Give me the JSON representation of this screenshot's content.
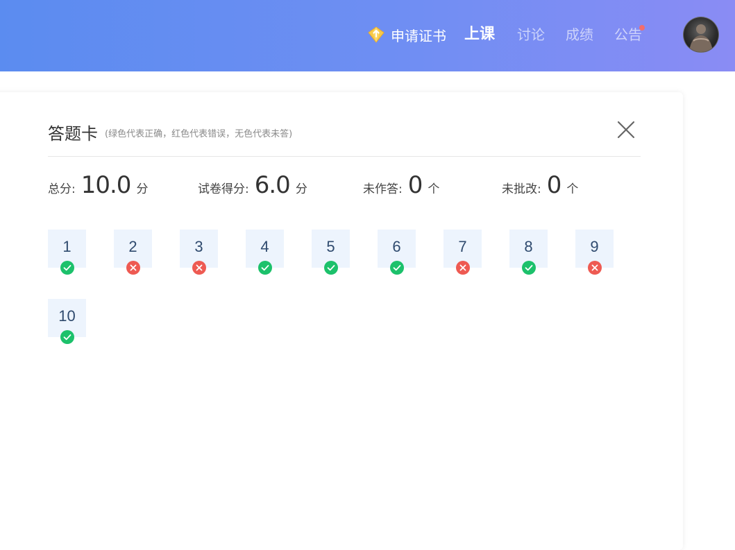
{
  "header": {
    "cert_label": "申请证书",
    "nav": [
      {
        "label": "上课",
        "active": true
      },
      {
        "label": "讨论",
        "active": false
      },
      {
        "label": "成绩",
        "active": false
      },
      {
        "label": "公告",
        "active": false,
        "dot": true
      }
    ],
    "colors": {
      "bar_start": "#5b8cf0",
      "bar_end": "#8a8cf4",
      "dot": "#f26d6d"
    }
  },
  "answer_card": {
    "title": "答题卡",
    "hint": "(绿色代表正确，红色代表错误，无色代表未答)",
    "stats": [
      {
        "label": "总分:",
        "value": "10.0",
        "unit": "分"
      },
      {
        "label": "试卷得分:",
        "value": "6.0",
        "unit": "分"
      },
      {
        "label": "未作答:",
        "value": "0",
        "unit": "个"
      },
      {
        "label": "未批改:",
        "value": "0",
        "unit": "个"
      }
    ],
    "questions": [
      {
        "num": "1",
        "status": "correct"
      },
      {
        "num": "2",
        "status": "wrong"
      },
      {
        "num": "3",
        "status": "wrong"
      },
      {
        "num": "4",
        "status": "correct"
      },
      {
        "num": "5",
        "status": "correct"
      },
      {
        "num": "6",
        "status": "correct"
      },
      {
        "num": "7",
        "status": "wrong"
      },
      {
        "num": "8",
        "status": "correct"
      },
      {
        "num": "9",
        "status": "wrong"
      },
      {
        "num": "10",
        "status": "correct"
      }
    ],
    "colors": {
      "correct": "#1cc16b",
      "wrong": "#ee5a52",
      "box": "#edf4fd"
    }
  }
}
